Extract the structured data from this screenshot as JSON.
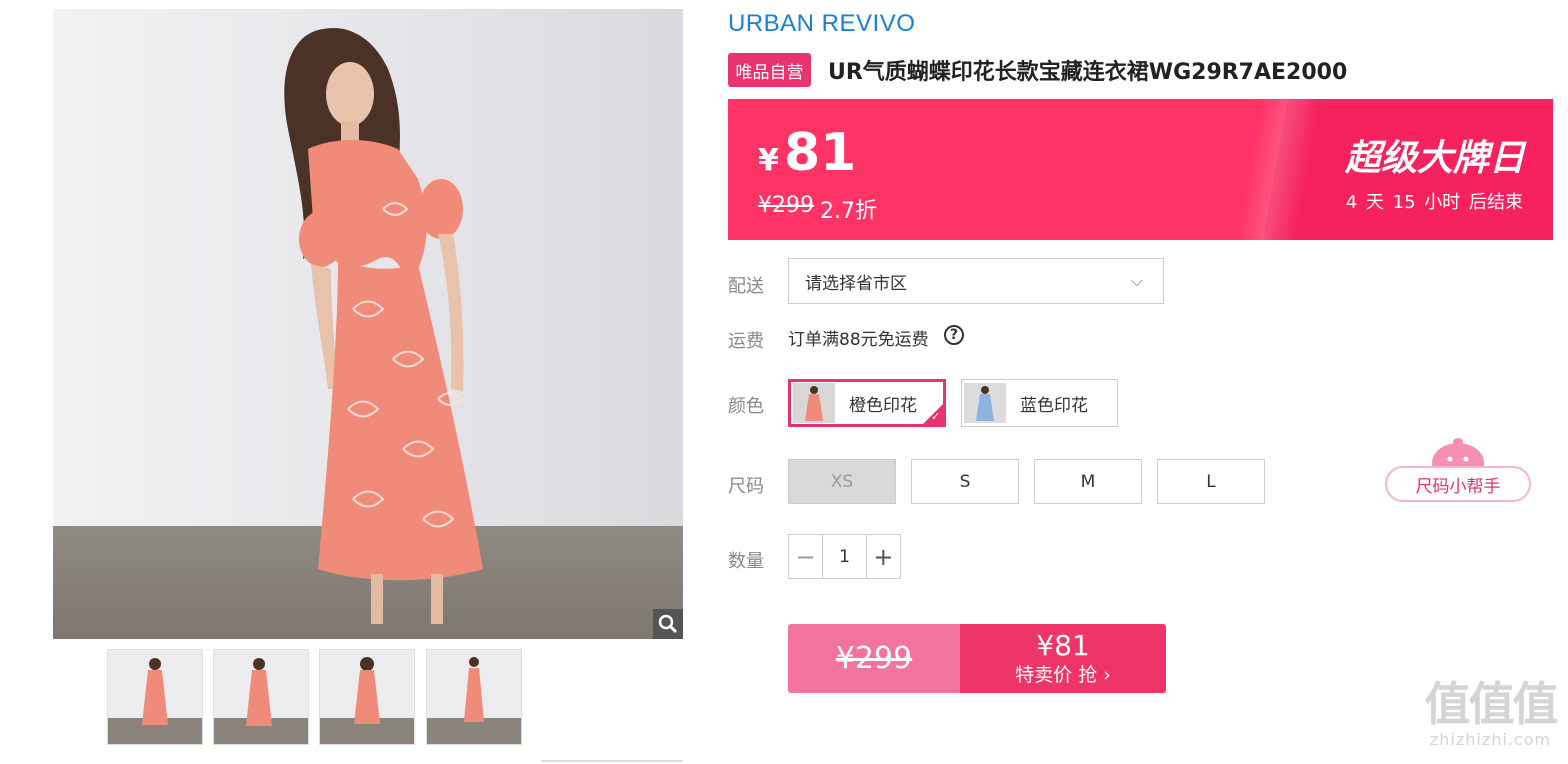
{
  "product": {
    "brand": "URBAN REVIVO",
    "badge": "唯品自营",
    "title": "UR气质蝴蝶印花长款宝藏连衣裙WG29R7AE2000"
  },
  "price_banner": {
    "currency": "¥",
    "sale_price": "81",
    "original_price": "¥299",
    "discount": "2.7折",
    "event_name": "超级大牌日",
    "countdown": "4 天 15 小时 后结束",
    "colors": {
      "banner": "#ff3366",
      "accent": "#e8336e"
    }
  },
  "delivery": {
    "label": "配送",
    "select_value": "请选择省市区"
  },
  "shipping": {
    "label": "运费",
    "text": "订单满88元免运费",
    "help_icon": "?"
  },
  "colors": {
    "label": "颜色",
    "options": [
      {
        "name": "橙色印花",
        "selected": true,
        "swatch": "#f08b7a"
      },
      {
        "name": "蓝色印花",
        "selected": false,
        "swatch": "#8eb3de"
      }
    ]
  },
  "sizes": {
    "label": "尺码",
    "options": [
      {
        "name": "XS",
        "available": false
      },
      {
        "name": "S",
        "available": true
      },
      {
        "name": "M",
        "available": true
      },
      {
        "name": "L",
        "available": true
      }
    ],
    "helper": "尺码小帮手"
  },
  "quantity": {
    "label": "数量",
    "minus": "−",
    "value": "1",
    "plus": "+"
  },
  "buy": {
    "original_price": "¥299",
    "sale_price": "¥81",
    "action": "特卖价 抢 ›"
  },
  "watermark": {
    "mark": "值值值",
    "domain": "zhizhizhi.com"
  },
  "icons": {
    "zoom": "magnifier-icon",
    "dropdown": "chevron-down-icon",
    "check": "check-icon"
  }
}
